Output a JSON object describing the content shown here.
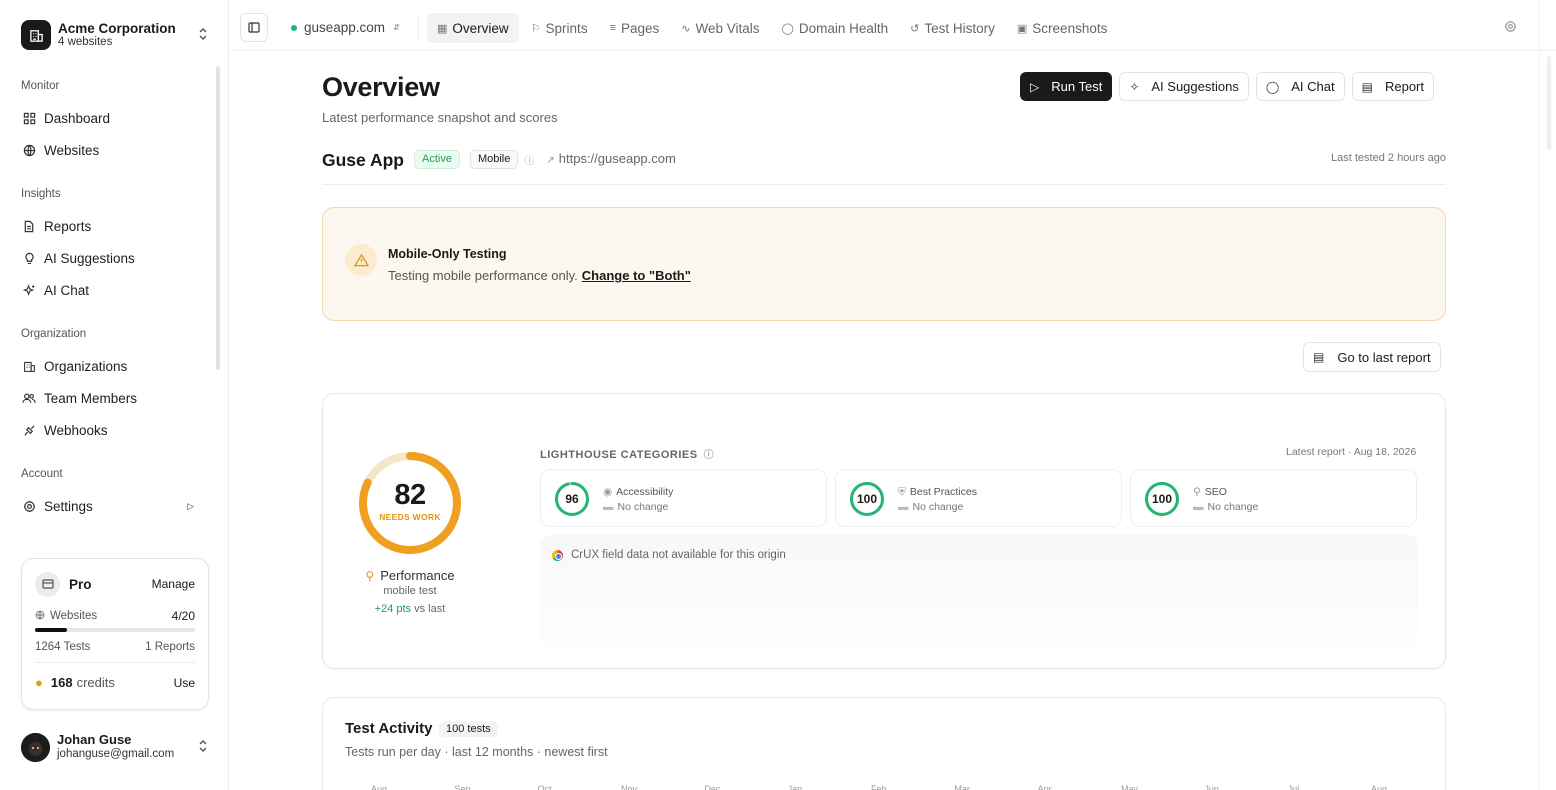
{
  "org": {
    "name": "Acme Corporation",
    "sub": "4 websites"
  },
  "sidebar": {
    "sections": [
      {
        "title": "Monitor",
        "items": [
          {
            "label": "Dashboard"
          },
          {
            "label": "Websites"
          }
        ]
      },
      {
        "title": "Insights",
        "items": [
          {
            "label": "Reports"
          },
          {
            "label": "AI Suggestions"
          },
          {
            "label": "AI Chat"
          }
        ]
      },
      {
        "title": "Organization",
        "items": [
          {
            "label": "Organizations"
          },
          {
            "label": "Team Members"
          },
          {
            "label": "Webhooks"
          }
        ]
      },
      {
        "title": "Account",
        "items": [
          {
            "label": "Settings"
          }
        ]
      }
    ]
  },
  "plan": {
    "name": "Pro",
    "manage": "Manage",
    "websites_label": "Websites",
    "websites_value": "4/20",
    "usage_fraction": 0.2,
    "tests": "1264 Tests",
    "reports": "1 Reports",
    "credits_num": "168",
    "credits_label": "credits",
    "use": "Use"
  },
  "user": {
    "name": "Johan Guse",
    "email": "johanguse@gmail.com"
  },
  "topbar": {
    "site": "guseapp.com",
    "tabs": [
      {
        "label": "Overview",
        "icon": "grid-icon",
        "active": true
      },
      {
        "label": "Sprints",
        "icon": "flag-icon"
      },
      {
        "label": "Pages",
        "icon": "list-icon"
      },
      {
        "label": "Web Vitals",
        "icon": "pulse-icon"
      },
      {
        "label": "Domain Health",
        "icon": "globe-icon"
      },
      {
        "label": "Test History",
        "icon": "history-icon"
      },
      {
        "label": "Screenshots",
        "icon": "image-icon"
      }
    ]
  },
  "page": {
    "title": "Overview",
    "subtitle": "Latest performance snapshot and scores"
  },
  "actions": {
    "run_test": "Run Test",
    "ai_suggestions": "AI Suggestions",
    "ai_chat": "AI Chat",
    "report": "Report"
  },
  "app": {
    "name": "Guse App",
    "status": "Active",
    "device": "Mobile",
    "url": "https://guseapp.com",
    "last_tested": "Last tested 2 hours ago"
  },
  "alert": {
    "title": "Mobile-Only Testing",
    "text": "Testing mobile performance only.",
    "link": "Change to \"Both\""
  },
  "go_last_report": "Go to last report",
  "performance": {
    "score": "82",
    "score_fraction": 0.82,
    "status": "NEEDS WORK",
    "label": "Performance",
    "sub": "mobile test",
    "delta": "+24 pts",
    "delta_suffix": "vs last"
  },
  "lighthouse": {
    "title": "LIGHTHOUSE CATEGORIES",
    "date": "Latest report · Aug 18, 2026",
    "categories": [
      {
        "score": "96",
        "fraction": 0.96,
        "name": "Accessibility",
        "change": "No change"
      },
      {
        "score": "100",
        "fraction": 1.0,
        "name": "Best Practices",
        "change": "No change"
      },
      {
        "score": "100",
        "fraction": 1.0,
        "name": "SEO",
        "change": "No change"
      }
    ],
    "crux": "CrUX field data not available for this origin"
  },
  "activity": {
    "title": "Test Activity",
    "count": "100 tests",
    "subtitle": "Tests run per day · last 12 months · newest first",
    "months": [
      "Aug",
      "Sep",
      "Oct",
      "Nov",
      "Dec",
      "Jan",
      "Feb",
      "Mar",
      "Apr",
      "May",
      "Jun",
      "Jul",
      "Aug"
    ]
  },
  "colors": {
    "accent_dark": "#1a1a1a",
    "green": "#22b573",
    "warning": "#f0a020"
  }
}
